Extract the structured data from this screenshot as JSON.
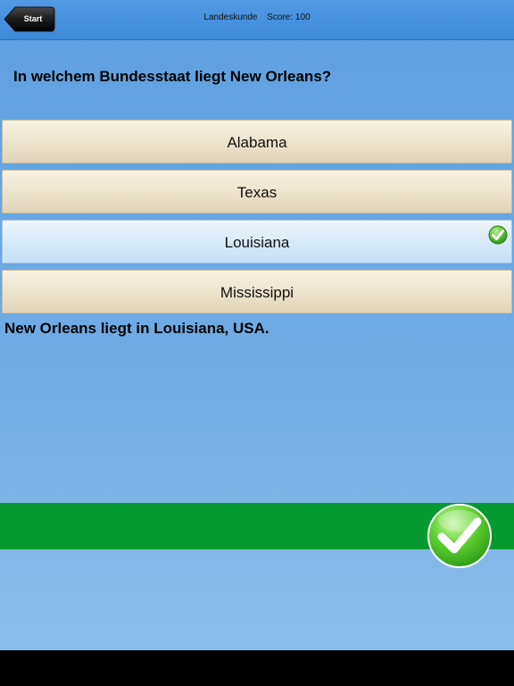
{
  "nav": {
    "back_label": "Start",
    "category": "Landeskunde",
    "score_text": "Score: 100"
  },
  "question": {
    "text": "In welchem Bundesstaat liegt New Orleans?"
  },
  "answers": [
    {
      "label": "Alabama",
      "selected": false
    },
    {
      "label": "Texas",
      "selected": false
    },
    {
      "label": "Louisiana",
      "selected": true,
      "status": "correct"
    },
    {
      "label": "Mississippi",
      "selected": false
    }
  ],
  "explanation": {
    "text": "New Orleans liegt in Louisiana, USA."
  },
  "result": {
    "status": "correct",
    "icon": "checkmark-icon",
    "bar_color": "#049a30"
  },
  "colors": {
    "background": "#6aa8e2",
    "nav_bar": "#3f8bd9",
    "answer_bg": "#ece2cc",
    "selected_bg": "#d5e9f8"
  }
}
